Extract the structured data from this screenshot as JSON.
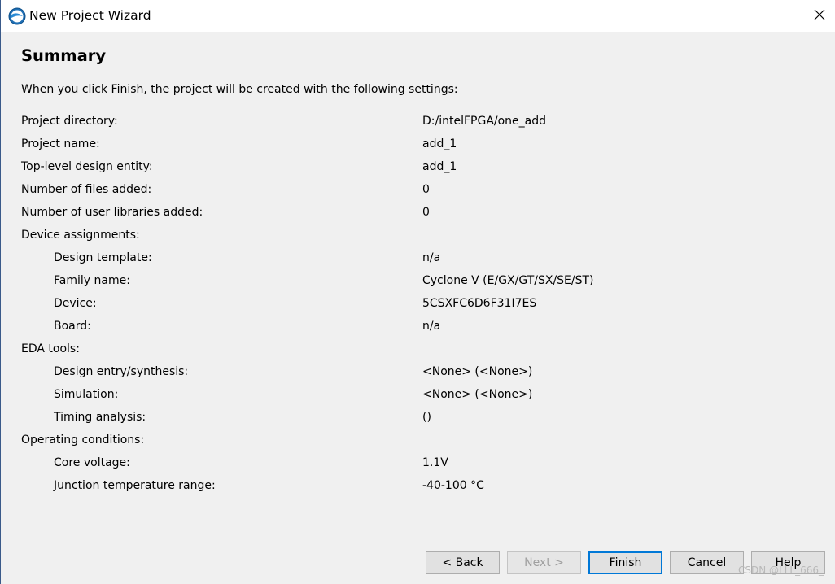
{
  "window": {
    "title": "New Project Wizard",
    "close_icon": "close-icon",
    "app_icon": "quartus-logo-icon"
  },
  "page": {
    "heading": "Summary",
    "intro": "When you click Finish, the project will be created with the following settings:"
  },
  "settings": [
    {
      "label": "Project directory:",
      "value": "D:/intelFPGA/one_add",
      "indent": false
    },
    {
      "label": "Project name:",
      "value": "add_1",
      "indent": false
    },
    {
      "label": "Top-level design entity:",
      "value": "add_1",
      "indent": false
    },
    {
      "label": "Number of files added:",
      "value": "0",
      "indent": false
    },
    {
      "label": "Number of user libraries added:",
      "value": "0",
      "indent": false
    },
    {
      "label": "Device assignments:",
      "value": "",
      "indent": false
    },
    {
      "label": "Design template:",
      "value": "n/a",
      "indent": true
    },
    {
      "label": "Family name:",
      "value": "Cyclone V (E/GX/GT/SX/SE/ST)",
      "indent": true
    },
    {
      "label": "Device:",
      "value": "5CSXFC6D6F31I7ES",
      "indent": true
    },
    {
      "label": "Board:",
      "value": "n/a",
      "indent": true
    },
    {
      "label": "EDA tools:",
      "value": "",
      "indent": false
    },
    {
      "label": "Design entry/synthesis:",
      "value": "<None> (<None>)",
      "indent": true
    },
    {
      "label": "Simulation:",
      "value": "<None> (<None>)",
      "indent": true
    },
    {
      "label": "Timing analysis:",
      "value": " ()",
      "indent": true
    },
    {
      "label": "Operating conditions:",
      "value": "",
      "indent": false
    },
    {
      "label": "Core voltage:",
      "value": "1.1V",
      "indent": true
    },
    {
      "label": "Junction temperature range:",
      "value": "-40-100 °C",
      "indent": true
    }
  ],
  "buttons": {
    "back": "< Back",
    "next": "Next >",
    "finish": "Finish",
    "cancel": "Cancel",
    "help": "Help"
  },
  "watermark": "CSDN @LLL_666_",
  "colors": {
    "background": "#f0f0f0",
    "titlebar": "#ffffff",
    "default_button_border": "#0078d7",
    "disabled_text": "#a0a0a0"
  }
}
